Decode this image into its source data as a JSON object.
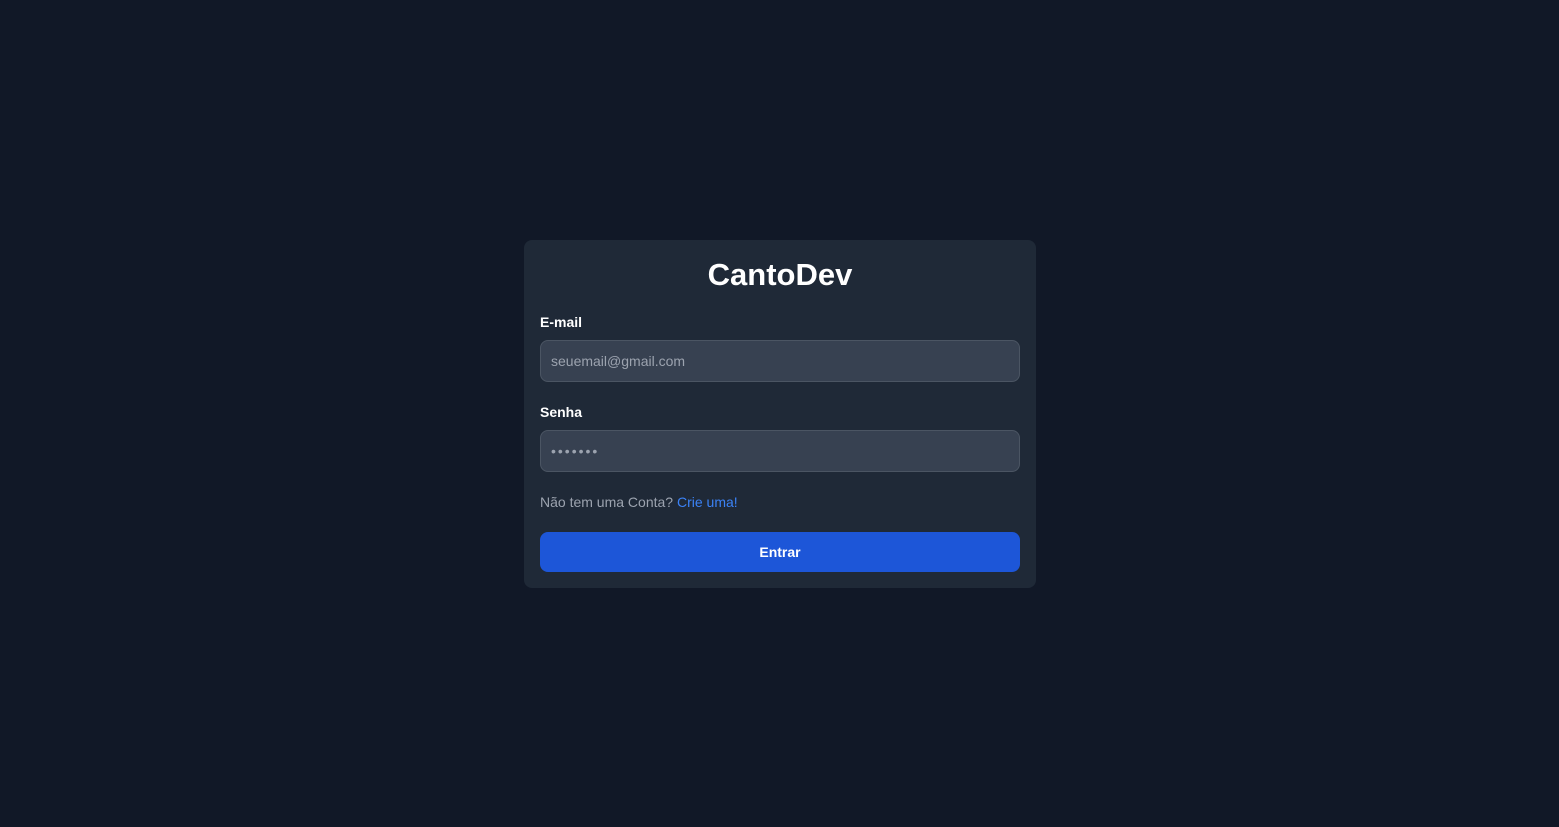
{
  "app": {
    "title": "CantoDev"
  },
  "form": {
    "email_label": "E-mail",
    "email_placeholder": "seuemail@gmail.com",
    "email_value": "",
    "password_label": "Senha",
    "password_placeholder": "•••••••",
    "password_value": "",
    "signup_prompt": "Não tem uma Conta?",
    "signup_link": "Crie uma!",
    "submit_label": "Entrar"
  },
  "colors": {
    "background": "#111827",
    "card": "#1f2937",
    "input": "#374151",
    "link": "#3b82f6",
    "button": "#1d56d8"
  }
}
